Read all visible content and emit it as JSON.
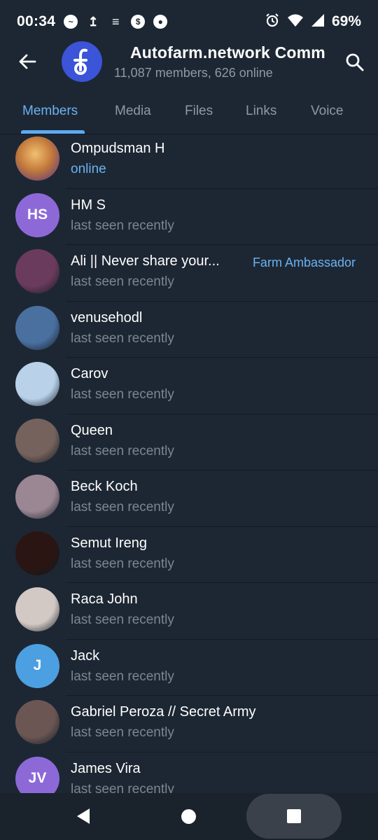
{
  "status_bar": {
    "time": "00:34",
    "battery": "69%",
    "left_icons": [
      "messenger-icon",
      "upload-icon",
      "ftx-icon",
      "dollar-coin-icon",
      "soccer-ball-icon"
    ],
    "right_icons": [
      "alarm-icon",
      "wifi-icon",
      "signal-icon"
    ]
  },
  "header": {
    "title": "Autofarm.network Comm",
    "subtitle": "11,087 members, 626 online",
    "avatar_letter": "d",
    "avatar_color": "#3b54d8"
  },
  "tabs": [
    {
      "label": "Members",
      "active": true
    },
    {
      "label": "Media",
      "active": false
    },
    {
      "label": "Files",
      "active": false
    },
    {
      "label": "Links",
      "active": false
    },
    {
      "label": "Voice",
      "active": false
    }
  ],
  "members": [
    {
      "name": "Ompudsman H",
      "status": "online",
      "initials": "",
      "color": "#e0a84a",
      "role": ""
    },
    {
      "name": "HM S",
      "status": "last seen recently",
      "initials": "HS",
      "color": "#8d69d8",
      "role": ""
    },
    {
      "name": "Ali || Never share your...",
      "status": "last seen recently",
      "initials": "",
      "color": "#6b3b5e",
      "role": "Farm Ambassador"
    },
    {
      "name": "venusehodl",
      "status": "last seen recently",
      "initials": "",
      "color": "#4a70a0",
      "role": ""
    },
    {
      "name": "Carov",
      "status": "last seen recently",
      "initials": "",
      "color": "#b9d2ea",
      "role": ""
    },
    {
      "name": "Queen",
      "status": "last seen recently",
      "initials": "",
      "color": "#75625c",
      "role": ""
    },
    {
      "name": "Beck Koch",
      "status": "last seen recently",
      "initials": "",
      "color": "#9a8793",
      "role": ""
    },
    {
      "name": "Semut Ireng",
      "status": "last seen recently",
      "initials": "",
      "color": "#2a1512",
      "role": ""
    },
    {
      "name": "Raca John",
      "status": "last seen recently",
      "initials": "",
      "color": "#d2c9c5",
      "role": ""
    },
    {
      "name": "Jack",
      "status": "last seen recently",
      "initials": "J",
      "color": "#4c9fe0",
      "role": ""
    },
    {
      "name": "Gabriel Peroza // Secret Army",
      "status": "last seen recently",
      "initials": "",
      "color": "#6c5654",
      "role": ""
    },
    {
      "name": "James Vira",
      "status": "last seen recently",
      "initials": "JV",
      "color": "#8d69d8",
      "role": ""
    }
  ]
}
